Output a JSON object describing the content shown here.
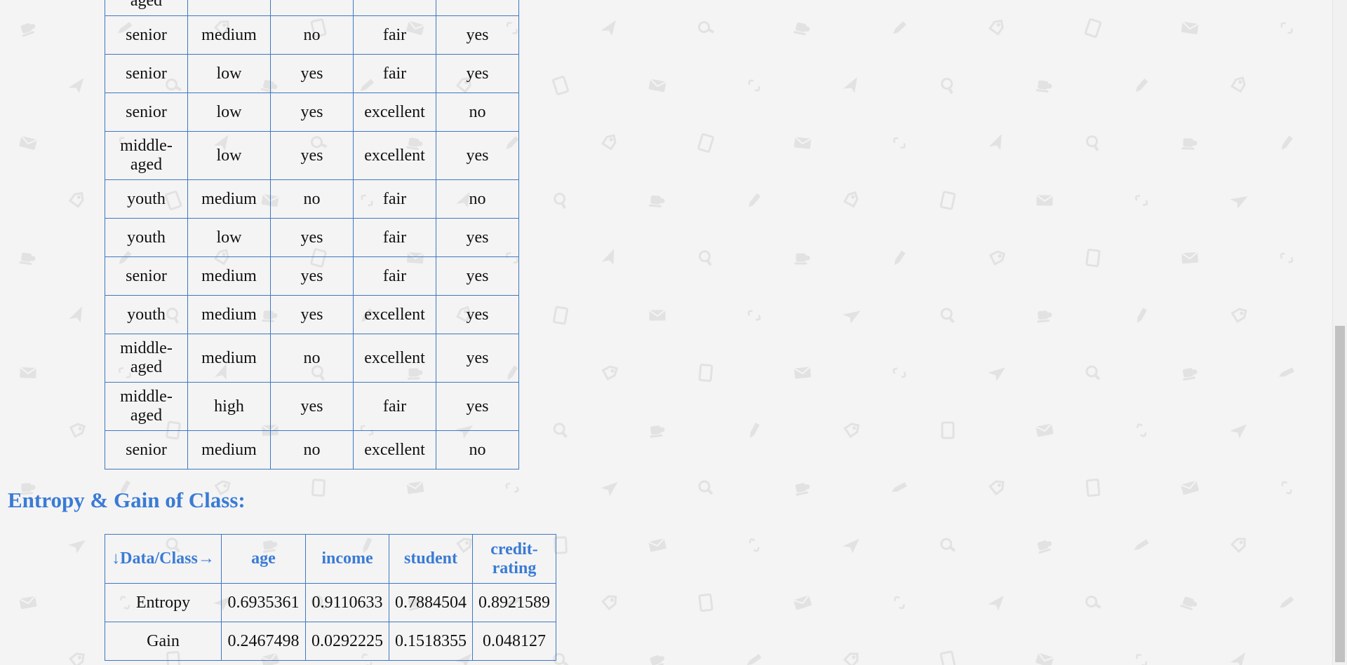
{
  "data_table": {
    "rows": [
      [
        "middle-aged",
        "",
        "",
        "",
        ""
      ],
      [
        "senior",
        "medium",
        "no",
        "fair",
        "yes"
      ],
      [
        "senior",
        "low",
        "yes",
        "fair",
        "yes"
      ],
      [
        "senior",
        "low",
        "yes",
        "excellent",
        "no"
      ],
      [
        "middle-aged",
        "low",
        "yes",
        "excellent",
        "yes"
      ],
      [
        "youth",
        "medium",
        "no",
        "fair",
        "no"
      ],
      [
        "youth",
        "low",
        "yes",
        "fair",
        "yes"
      ],
      [
        "senior",
        "medium",
        "yes",
        "fair",
        "yes"
      ],
      [
        "youth",
        "medium",
        "yes",
        "excellent",
        "yes"
      ],
      [
        "middle-aged",
        "medium",
        "no",
        "excellent",
        "yes"
      ],
      [
        "middle-aged",
        "high",
        "yes",
        "fair",
        "yes"
      ],
      [
        "senior",
        "medium",
        "no",
        "excellent",
        "no"
      ]
    ]
  },
  "gain_section": {
    "heading": "Entropy & Gain of Class:",
    "headers": [
      "↓Data/Class→",
      "age",
      "income",
      "student",
      "credit-rating"
    ],
    "rows": [
      [
        "Entropy",
        "0.6935361",
        "0.9110633",
        "0.7884504",
        "0.8921589"
      ],
      [
        "Gain",
        "0.2467498",
        "0.0292225",
        "0.1518355",
        "0.048127"
      ]
    ]
  },
  "colors": {
    "accent": "#3a7bd5",
    "border": "#3f78c3",
    "background": "#f4f4f4",
    "pattern_icons": "#e2e2e2"
  },
  "pattern_icon_names": [
    "coffee-cup-icon",
    "pencil-icon",
    "tag-icon",
    "tablet-icon",
    "envelope-icon",
    "expand-icon",
    "paper-plane-icon",
    "magnifier-icon"
  ]
}
